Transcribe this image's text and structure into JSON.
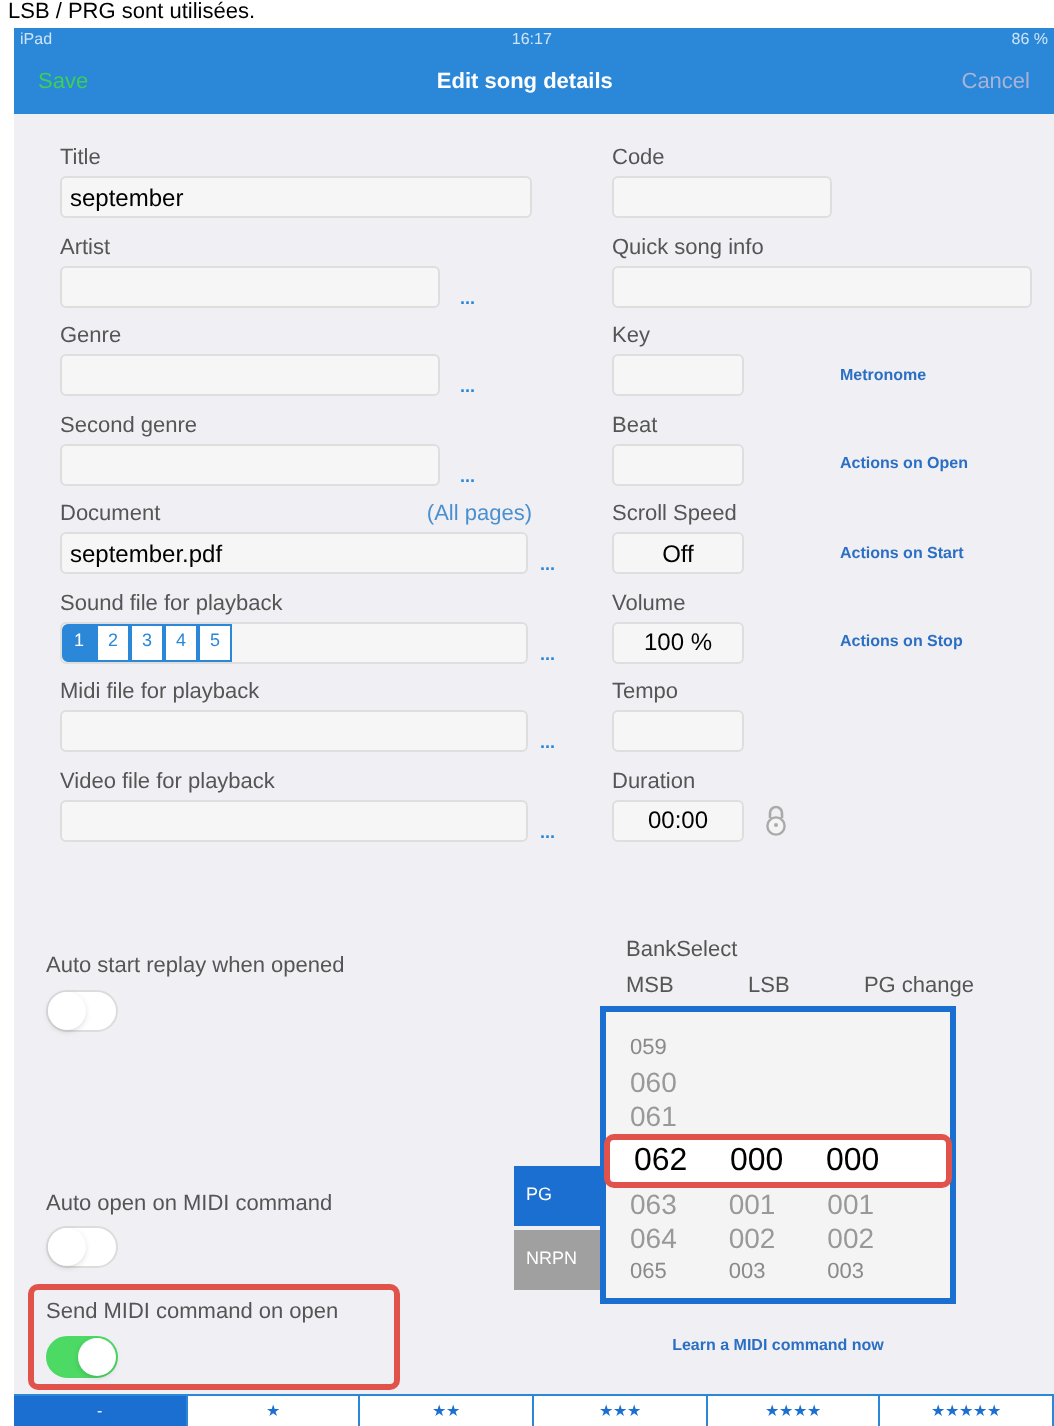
{
  "caption": "LSB / PRG sont utilisées.",
  "status_bar": {
    "carrier": "iPad",
    "time": "16:17",
    "battery": "86 %"
  },
  "nav": {
    "save": "Save",
    "title": "Edit song details",
    "cancel": "Cancel"
  },
  "left_fields": [
    {
      "kind": "text",
      "label": "Title",
      "value": "september"
    },
    {
      "kind": "text",
      "label": "Artist",
      "more": "..."
    },
    {
      "kind": "text",
      "label": "Genre",
      "more": "..."
    },
    {
      "kind": "text",
      "label": "Second genre",
      "more": "..."
    },
    {
      "kind": "text",
      "label": "Document",
      "note": "(All pages)",
      "value": "september.pdf",
      "more": "..."
    },
    {
      "kind": "segments",
      "label": "Sound file for playback",
      "more": "...",
      "segments": [
        {
          "label": "1",
          "selected": true
        },
        {
          "label": "2",
          "selected": false
        },
        {
          "label": "3",
          "selected": false
        },
        {
          "label": "4",
          "selected": false
        },
        {
          "label": "5",
          "selected": false
        }
      ]
    },
    {
      "kind": "text",
      "label": "Midi file for playback",
      "more": "..."
    },
    {
      "kind": "text",
      "label": "Video file for playback",
      "more": "..."
    }
  ],
  "right_fields": [
    {
      "label": "Code"
    },
    {
      "label": "Quick song info"
    },
    {
      "label": "Key",
      "link": "Metronome"
    },
    {
      "label": "Beat",
      "link": "Actions on Open"
    },
    {
      "label": "Scroll Speed",
      "value": "Off",
      "link": "Actions on Start"
    },
    {
      "label": "Volume",
      "value": "100 %",
      "link": "Actions on Stop"
    },
    {
      "label": "Tempo"
    },
    {
      "label": "Duration",
      "value": "00:00",
      "locked": true
    }
  ],
  "toggles": [
    {
      "label": "Auto start replay when opened",
      "on": false,
      "highlighted": false
    },
    {
      "label": "Auto open on MIDI command",
      "on": false,
      "highlighted": false
    },
    {
      "label": "Send MIDI command on open",
      "on": true,
      "highlighted": true
    }
  ],
  "midi": {
    "title": "BankSelect",
    "columns": [
      "MSB",
      "LSB",
      "PG change"
    ],
    "modes": [
      {
        "label": "PG",
        "selected": true
      },
      {
        "label": "NRPN",
        "selected": false
      }
    ],
    "rows": [
      {
        "values": [
          "059"
        ],
        "selected": false
      },
      {
        "values": [
          "060"
        ],
        "selected": false
      },
      {
        "values": [
          "061"
        ],
        "selected": false
      },
      {
        "values": [
          "062",
          "000",
          "000"
        ],
        "selected": true,
        "highlighted": true
      },
      {
        "values": [
          "063",
          "001",
          "001"
        ],
        "selected": false
      },
      {
        "values": [
          "064",
          "002",
          "002"
        ],
        "selected": false
      },
      {
        "values": [
          "065",
          "003",
          "003"
        ],
        "selected": false
      }
    ],
    "learn": "Learn a MIDI command now"
  },
  "rating_tabs": [
    {
      "label": "-",
      "selected": true
    },
    {
      "label": "★",
      "selected": false
    },
    {
      "label": "★★",
      "selected": false
    },
    {
      "label": "★★★",
      "selected": false
    },
    {
      "label": "★★★★",
      "selected": false
    },
    {
      "label": "★★★★★",
      "selected": false
    }
  ]
}
